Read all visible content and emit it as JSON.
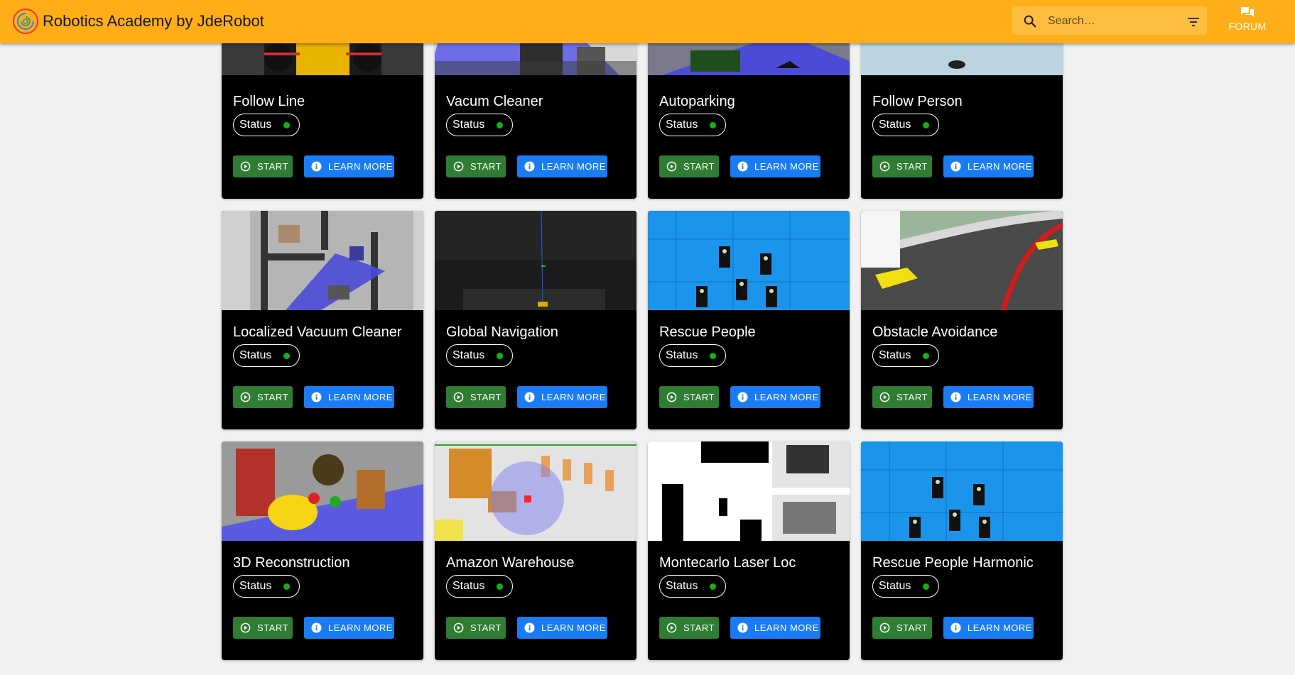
{
  "app": {
    "title": "Robotics Academy by JdeRobot",
    "search_placeholder": "Search…",
    "forum_label": "FORUM",
    "accent_color": "#ffae18"
  },
  "card_labels": {
    "status": "Status",
    "start": "START",
    "learn_more": "LEARN MORE"
  },
  "exercises": [
    {
      "title": "Follow Line",
      "status": "online",
      "thumbnail": "f1-car-cockpit"
    },
    {
      "title": "Vacum Cleaner",
      "status": "online",
      "thumbnail": "vacuum-robot-house"
    },
    {
      "title": "Autoparking",
      "status": "online",
      "thumbnail": "car-parking-laser"
    },
    {
      "title": "Follow Person",
      "status": "online",
      "thumbnail": "hospital-person"
    },
    {
      "title": "Localized Vacuum Cleaner",
      "status": "online",
      "thumbnail": "house-floorplan-laser"
    },
    {
      "title": "Global Navigation",
      "status": "online",
      "thumbnail": "city-taxi-navigation"
    },
    {
      "title": "Rescue People",
      "status": "online",
      "thumbnail": "ocean-people-drone"
    },
    {
      "title": "Obstacle Avoidance",
      "status": "online",
      "thumbnail": "race-track-f1"
    },
    {
      "title": "3D Reconstruction",
      "status": "online",
      "thumbnail": "toys-scene"
    },
    {
      "title": "Amazon Warehouse",
      "status": "online",
      "thumbnail": "warehouse-shelves"
    },
    {
      "title": "Montecarlo Laser Loc",
      "status": "online",
      "thumbnail": "map-and-house-views"
    },
    {
      "title": "Rescue People Harmonic",
      "status": "online",
      "thumbnail": "ocean-people-drone"
    }
  ]
}
